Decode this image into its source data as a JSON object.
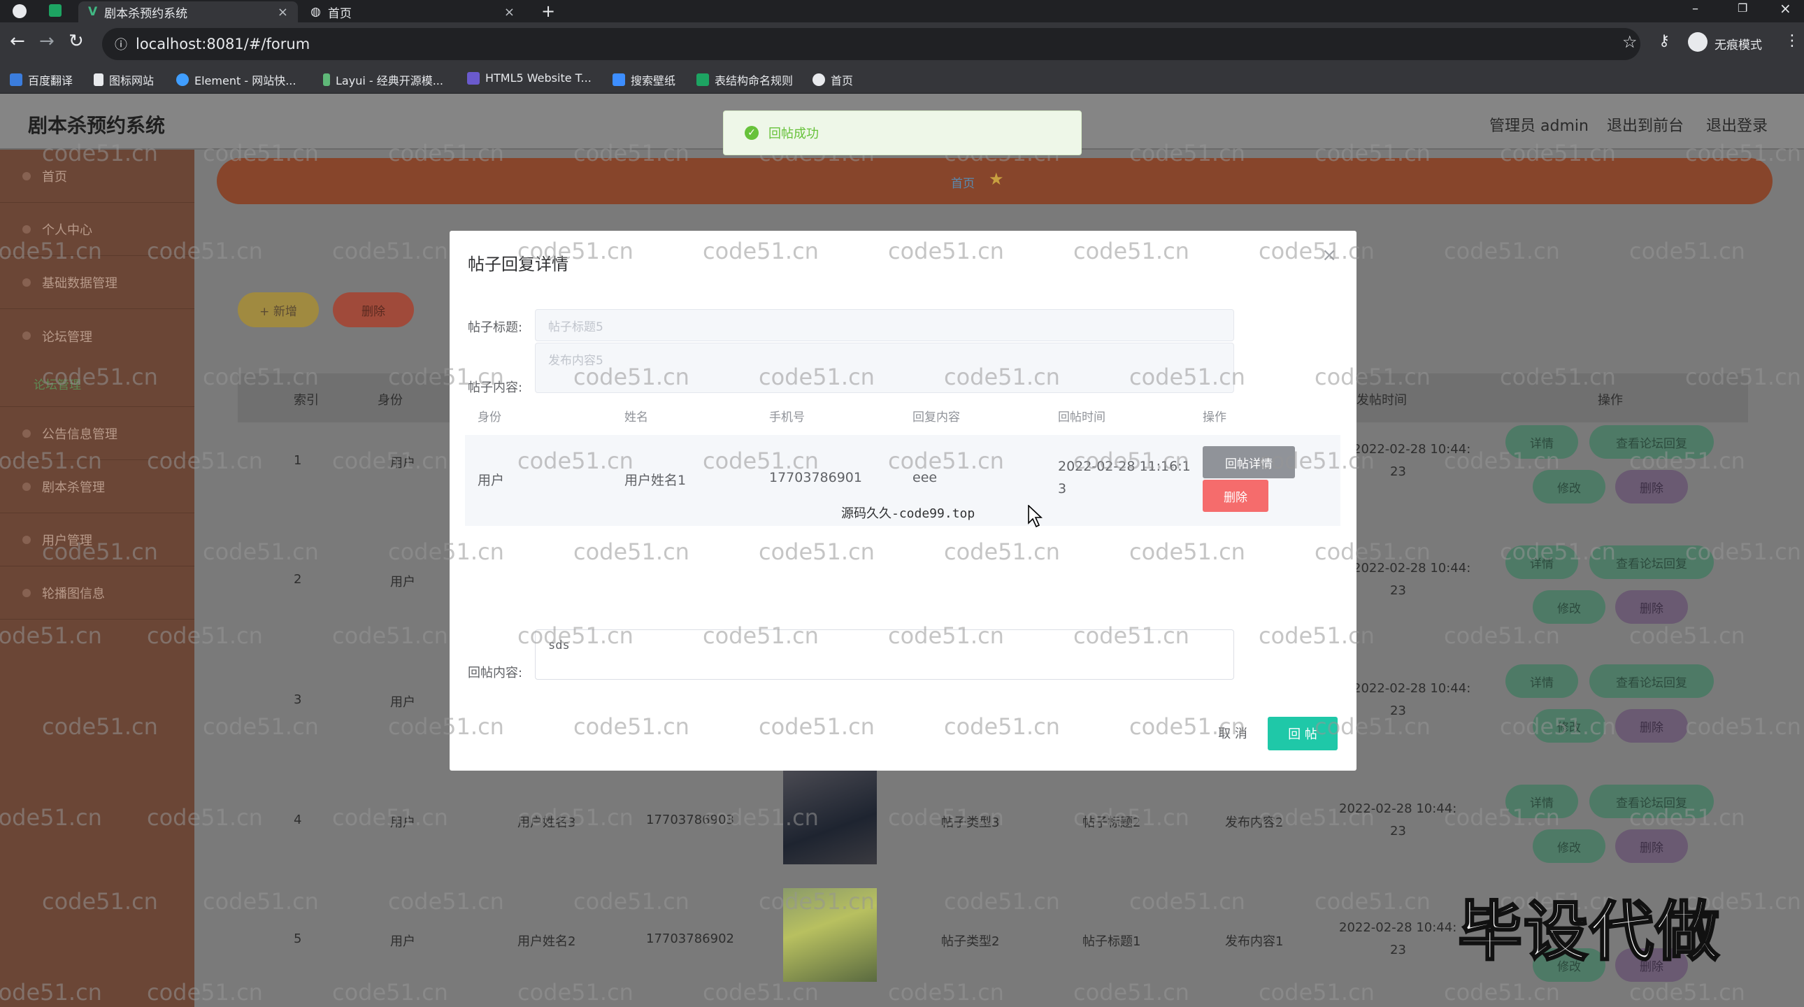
{
  "browser": {
    "tabs": [
      {
        "label": "剧本杀预约系统"
      },
      {
        "label": "首页"
      }
    ],
    "url": "localhost:8081/#/forum",
    "profile": "无痕模式",
    "bookmarks": [
      "百度翻译",
      "图标网站",
      "Element - 网站快...",
      "Layui - 经典开源模...",
      "HTML5 Website T...",
      "搜索壁纸",
      "表结构命名规则",
      "首页"
    ]
  },
  "app": {
    "title": "剧本杀预约系统",
    "header_links": [
      "管理员 admin",
      "退出到前台",
      "退出登录"
    ],
    "sidebar": [
      "首页",
      "个人中心",
      "基础数据管理",
      "论坛管理",
      "公告信息管理",
      "剧本杀管理",
      "用户管理",
      "轮播图信息"
    ],
    "sidebar_sub": "论坛管理",
    "breadcrumb": "首页",
    "toolbar": {
      "add": "+ 新增",
      "delete": "删除"
    },
    "table_headers": [
      "索引",
      "身份",
      "发帖时间",
      "操作"
    ],
    "rows": [
      {
        "index": "1",
        "role": "用户",
        "time1": "2022-02-28 10:44:",
        "time2": "23"
      },
      {
        "index": "2",
        "role": "用户",
        "time1": "2022-02-28 10:44:",
        "time2": "23"
      },
      {
        "index": "3",
        "role": "用户",
        "time1": "2022-02-28 10:44:",
        "time2": "23"
      },
      {
        "index": "4",
        "role": "用户",
        "name": "用户姓名3",
        "phone": "17703786903",
        "type": "帖子类型3",
        "title": "帖子标题2",
        "content": "发布内容2",
        "time1": "2022-02-28 10:44:",
        "time2": "23"
      },
      {
        "index": "5",
        "role": "用户",
        "name": "用户姓名2",
        "phone": "17703786902",
        "type": "帖子类型2",
        "title": "帖子标题1",
        "content": "发布内容1",
        "time1": "2022-02-28 10:44:",
        "time2": "23"
      }
    ],
    "row_actions": {
      "detail": "详情",
      "view_replies": "查看论坛回复",
      "edit": "修改",
      "delete": "删除"
    }
  },
  "toast": {
    "message": "回帖成功",
    "color": "#67c23a"
  },
  "modal": {
    "title": "帖子回复详情",
    "post_title_label": "帖子标题:",
    "post_title_placeholder": "帖子标题5",
    "post_content_label": "帖子内容:",
    "post_content_placeholder": "发布内容5",
    "reply_headers": [
      "身份",
      "姓名",
      "手机号",
      "回复内容",
      "回帖时间",
      "操作"
    ],
    "reply_row": {
      "role": "用户",
      "name": "用户姓名1",
      "phone": "17703786901",
      "content": "eee",
      "time_line1": "2022-02-28 11:16:1",
      "time_line2": "3",
      "detail_btn": "回帖详情",
      "delete_btn": "删除"
    },
    "reply_label": "回帖内容:",
    "reply_value": "sds",
    "cancel": "取 消",
    "submit": "回 帖"
  },
  "overlay_caption": "源码久久-code99.top",
  "watermark_text": "code51.cn",
  "corner_mark": "毕设代做"
}
